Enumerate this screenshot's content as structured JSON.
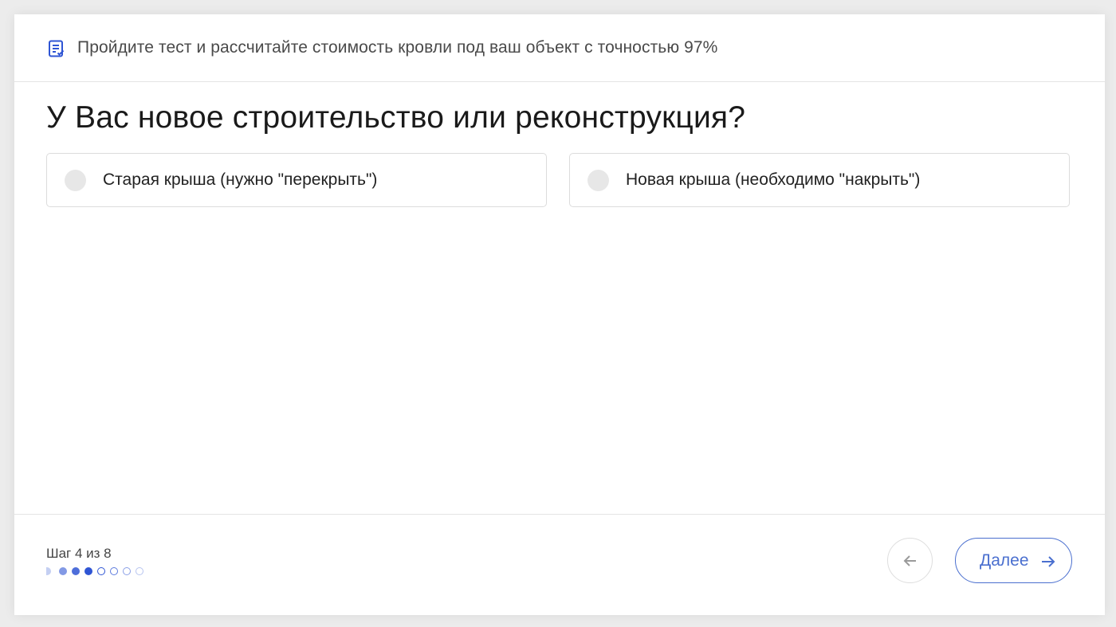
{
  "header": {
    "icon": "quiz-list-icon",
    "text": "Пройдите тест и рассчитайте стоимость кровли под ваш объект с точностью 97%"
  },
  "question": {
    "title": "У Вас новое строительство или реконструкция?"
  },
  "options": [
    {
      "label": "Старая крыша (нужно \"перекрыть\")",
      "selected": false
    },
    {
      "label": "Новая крыша (необходимо \"накрыть\")",
      "selected": false
    }
  ],
  "footer": {
    "step_text": "Шаг 4 из 8",
    "current_step": 4,
    "total_steps": 8,
    "back_icon": "arrow-left-icon",
    "next_label": "Далее",
    "next_icon": "arrow-right-icon"
  },
  "colors": {
    "accent": "#2f55d4",
    "accent_light": "#4a6fcf",
    "muted_dot": "#8aa0e6"
  }
}
